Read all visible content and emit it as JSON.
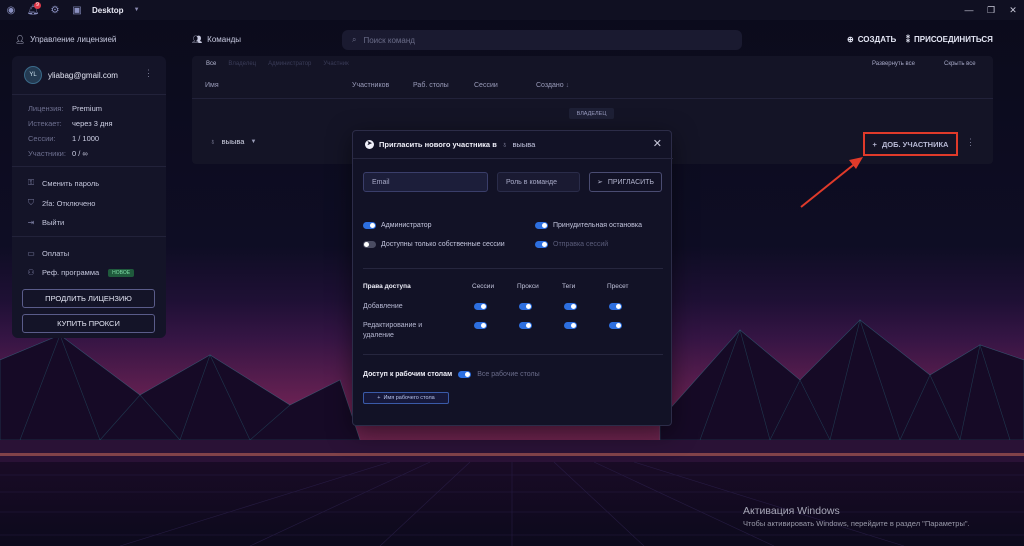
{
  "titlebar": {
    "title": "Desktop",
    "notification_count": "9"
  },
  "header": {
    "license_mgmt": "Управление лицензией",
    "teams": "Команды",
    "search_placeholder": "Поиск команд",
    "create": "СОЗДАТЬ",
    "join": "ПРИСОЕДИНИТЬСЯ"
  },
  "sidebar": {
    "avatar": "YL",
    "email": "yliabag@gmail.com",
    "license": {
      "k": "Лицензия:",
      "v": "Premium"
    },
    "expires": {
      "k": "Истекает:",
      "v": "через 3 дня"
    },
    "sessions": {
      "k": "Сессии:",
      "v": "1 / 1000"
    },
    "members": {
      "k": "Участники:",
      "v": "0 / ∞"
    },
    "change_password": "Сменить пароль",
    "twofa": "2fa: Отключено",
    "logout": "Выйти",
    "payments": "Оплаты",
    "referral": "Реф. программа",
    "referral_badge": "НОВОЕ",
    "extend_license": "ПРОДЛИТЬ ЛИЦЕНЗИЮ",
    "buy_proxy": "КУПИТЬ ПРОКСИ"
  },
  "panel": {
    "tabs": [
      "Все",
      "Владелец",
      "Администратор",
      "Участник"
    ],
    "expand_all": "Развернуть все",
    "collapse_all": "Скрыть все",
    "columns": {
      "name": "Имя",
      "members": "Участников",
      "desktops": "Раб. столы",
      "sessions": "Сессии",
      "created": "Создано"
    },
    "owner_badge": "ВЛАДЕЛЕЦ",
    "team_name": "выыва",
    "add_member": "ДОБ. УЧАСТНИКА"
  },
  "modal": {
    "title": "Пригласить нового участника в",
    "team_name": "выыва",
    "email_placeholder": "Email",
    "role_placeholder": "Роль в команде",
    "invite": "ПРИГЛАСИТЬ",
    "toggles": {
      "admin": {
        "label": "Администратор",
        "on": true
      },
      "force_stop": {
        "label": "Принудительная остановка",
        "on": true
      },
      "own_sessions": {
        "label": "Доступны только собственные сессии",
        "on": false
      },
      "send_sessions": {
        "label": "Отправка сессий",
        "on": true
      }
    },
    "perms": {
      "title": "Права доступа",
      "headers": [
        "Сессии",
        "Прокси",
        "Теги",
        "Пресет"
      ],
      "add": "Добавление",
      "edit": "Редактирование и удаление"
    },
    "desktop_access": "Доступ к рабочим столам",
    "all_desktops": "Все рабочие столы",
    "desktop_name_btn": "Имя рабочего стола"
  },
  "watermark": {
    "line1": "Активация Windows",
    "line2": "Чтобы активировать Windows, перейдите в раздел \"Параметры\"."
  },
  "colors": {
    "accent": "#2d6fe0",
    "annotation": "#e03a2a"
  }
}
